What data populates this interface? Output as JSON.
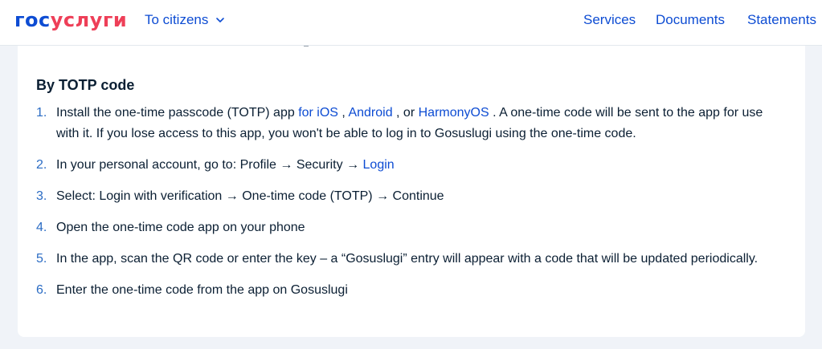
{
  "header": {
    "logo_part1": "гос",
    "logo_part2": "услуги",
    "citizens_menu": "To citizens",
    "nav": {
      "services": "Services",
      "documents": "Documents",
      "statements": "Statements"
    }
  },
  "content": {
    "section_title": "By TOTP code",
    "steps": [
      {
        "number": "1.",
        "t1": "Install the one-time passcode (TOTP) app ",
        "link_ios": "for iOS",
        "t2": " , ",
        "link_android": "Android",
        "t3": " , or ",
        "link_harmony": "HarmonyOS",
        "t4": " . A one-time code will be sent to the app for use with it. If you lose access to this app, you won't be able to log in to Gosuslugi using the one-time code."
      },
      {
        "number": "2.",
        "t1": "In your personal account, go to: Profile → Security → ",
        "link_login": "Login"
      },
      {
        "number": "3.",
        "text": "Select: Login with verification → One-time code (TOTP) → Continue"
      },
      {
        "number": "4.",
        "text": "Open the one-time code app on your phone"
      },
      {
        "number": "5.",
        "text": "In the app, scan the QR code or enter the key – a “Gosuslugi” entry will appear with a code that will be updated periodically."
      },
      {
        "number": "6.",
        "text": "Enter the one-time code from the app on Gosuslugi"
      }
    ]
  },
  "colors": {
    "brand_blue": "#0d4cd3",
    "brand_red": "#ee3f58",
    "page_bg": "#f0f3f8",
    "text": "#0b1f33"
  }
}
